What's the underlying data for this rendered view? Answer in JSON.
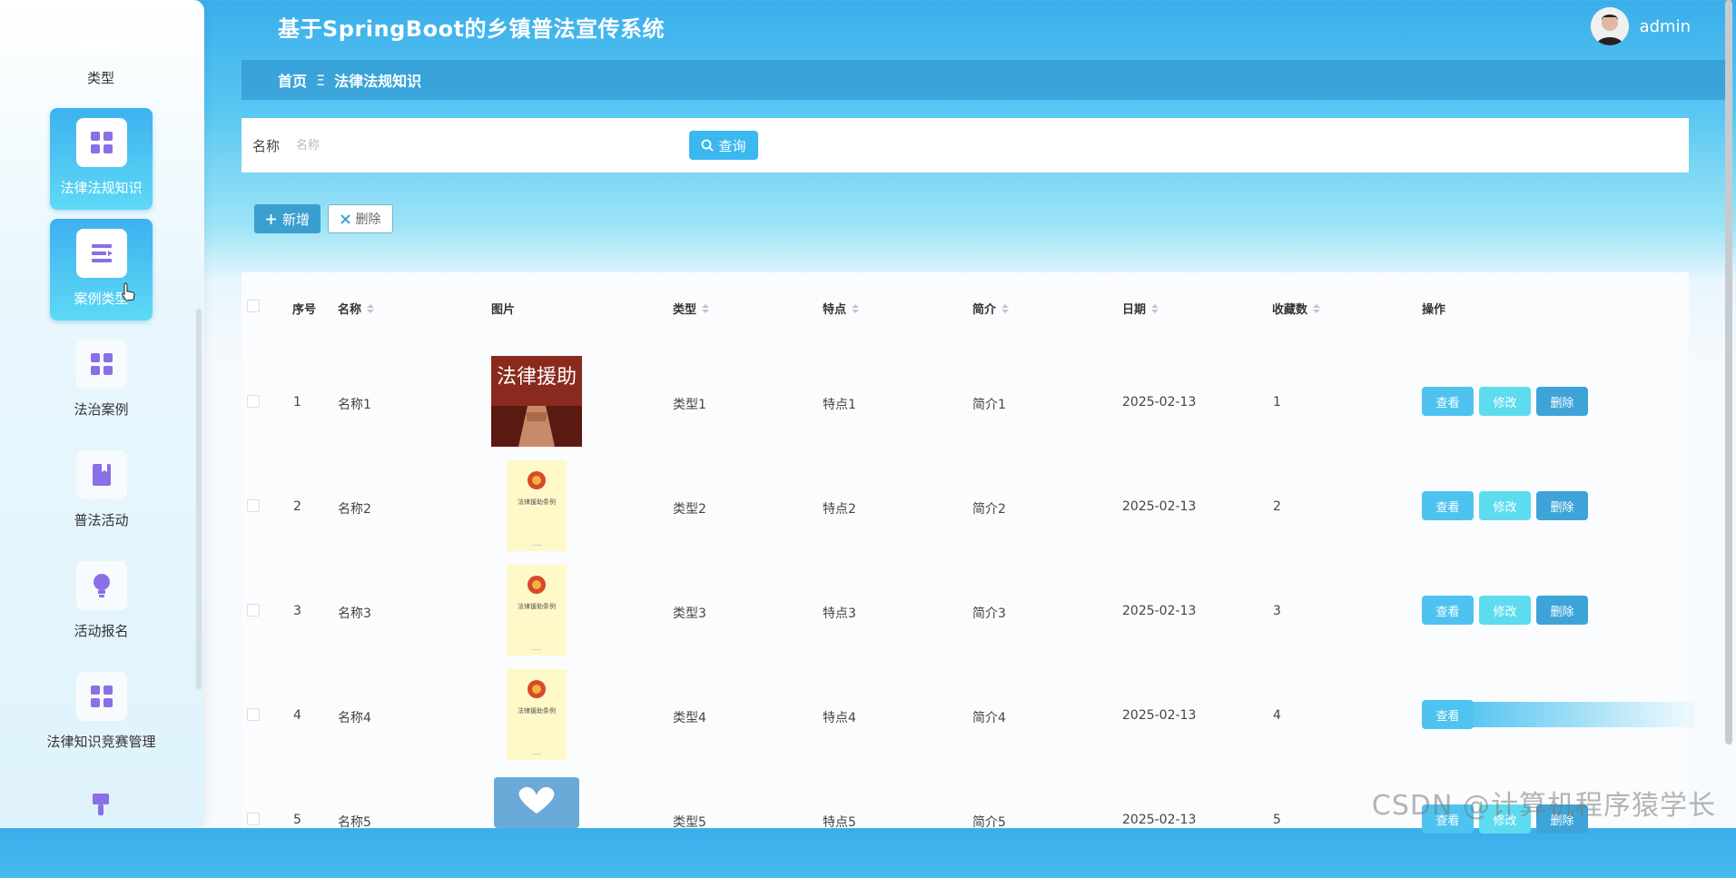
{
  "app": {
    "title": "基于SpringBoot的乡镇普法宣传系统",
    "user": "admin"
  },
  "breadcrumb": {
    "home": "首页",
    "separator": "Ξ",
    "current": "法律法规知识"
  },
  "sidebar": {
    "items": [
      {
        "label": "类型",
        "icon": "partial-icon"
      },
      {
        "label": "法律法规知识",
        "icon": "grid-icon",
        "active": true
      },
      {
        "label": "案例类型",
        "icon": "list-icon",
        "active": true
      },
      {
        "label": "法治案例",
        "icon": "grid-icon"
      },
      {
        "label": "普法活动",
        "icon": "book-icon"
      },
      {
        "label": "活动报名",
        "icon": "bulb-icon"
      },
      {
        "label": "法律知识竞赛管理",
        "icon": "grid-icon"
      },
      {
        "label": "",
        "icon": "brush-icon"
      }
    ]
  },
  "search": {
    "label": "名称",
    "placeholder": "名称",
    "button": "查询"
  },
  "actions": {
    "add": "新增",
    "delete": "删除"
  },
  "table": {
    "columns": [
      "序号",
      "名称",
      "图片",
      "类型",
      "特点",
      "简介",
      "日期",
      "收藏数",
      "操作"
    ],
    "rows": [
      {
        "index": "1",
        "name": "名称1",
        "image": "法律援助",
        "type": "类型1",
        "feature": "特点1",
        "intro": "简介1",
        "date": "2025-02-13",
        "favorites": "1"
      },
      {
        "index": "2",
        "name": "名称2",
        "image": "法律援助条例",
        "type": "类型2",
        "feature": "特点2",
        "intro": "简介2",
        "date": "2025-02-13",
        "favorites": "2"
      },
      {
        "index": "3",
        "name": "名称3",
        "image": "法律援助条例",
        "type": "类型3",
        "feature": "特点3",
        "intro": "简介3",
        "date": "2025-02-13",
        "favorites": "3"
      },
      {
        "index": "4",
        "name": "名称4",
        "image": "法律援助条例",
        "type": "类型4",
        "feature": "特点4",
        "intro": "简介4",
        "date": "2025-02-13",
        "favorites": "4"
      },
      {
        "index": "5",
        "name": "名称5",
        "image": "",
        "type": "类型5",
        "feature": "特点5",
        "intro": "简介5",
        "date": "2025-02-13",
        "favorites": "5"
      }
    ],
    "row_buttons": {
      "view": "查看",
      "edit": "修改",
      "delete": "删除"
    }
  },
  "watermark": "CSDN @计算机程序猿学长",
  "colors": {
    "accent": "#3ab8ef",
    "header": "#3aaeea",
    "active_menu": "#3db1ef"
  }
}
